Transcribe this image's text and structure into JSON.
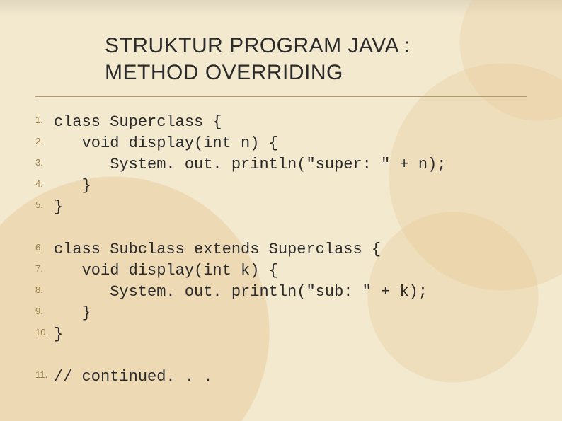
{
  "title": {
    "line1": "STRUKTUR PROGRAM JAVA :",
    "line2": "METHOD OVERRIDING"
  },
  "code": {
    "lines": [
      {
        "n": "1.",
        "text": "class Superclass {"
      },
      {
        "n": "2.",
        "text": "   void display(int n) {"
      },
      {
        "n": "3.",
        "text": "      System. out. println(\"super: \" + n);"
      },
      {
        "n": "4.",
        "text": "   }"
      },
      {
        "n": "5.",
        "text": "}"
      },
      {
        "n": "",
        "text": ""
      },
      {
        "n": "6.",
        "text": "class Subclass extends Superclass {"
      },
      {
        "n": "7.",
        "text": "   void display(int k) {"
      },
      {
        "n": "8.",
        "text": "      System. out. println(\"sub: \" + k);"
      },
      {
        "n": "9.",
        "text": "   }"
      },
      {
        "n": "10.",
        "text": "}"
      },
      {
        "n": "",
        "text": ""
      },
      {
        "n": "11.",
        "text": "// continued. . ."
      }
    ]
  }
}
